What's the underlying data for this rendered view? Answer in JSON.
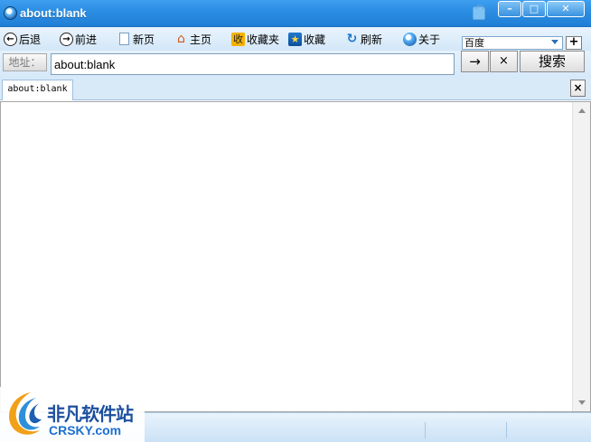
{
  "window": {
    "title": "about:blank",
    "controls": {
      "minimize": "–",
      "maximize": "□",
      "close": "✕"
    }
  },
  "toolbar": {
    "back": "后退",
    "forward": "前进",
    "new_page": "新页",
    "home": "主页",
    "favorites": "收藏夹",
    "favorites_icon_text": "收",
    "add_favorite": "收藏",
    "refresh": "刷新",
    "about": "关于",
    "search_engine": "百度",
    "add_engine": "+"
  },
  "address": {
    "label": "地址：",
    "value": "about:blank",
    "go": "→",
    "stop": "×",
    "search": "搜索"
  },
  "tabs": [
    {
      "label": "about:blank"
    }
  ],
  "tab_close": "×",
  "watermark": {
    "cn": "非凡软件站",
    "en": "CRSKY.com"
  },
  "colors": {
    "title_bar": "#2b8de2",
    "toolbar_bg": "#d3e7f8",
    "watermark_blue": "#1d4f9e"
  }
}
